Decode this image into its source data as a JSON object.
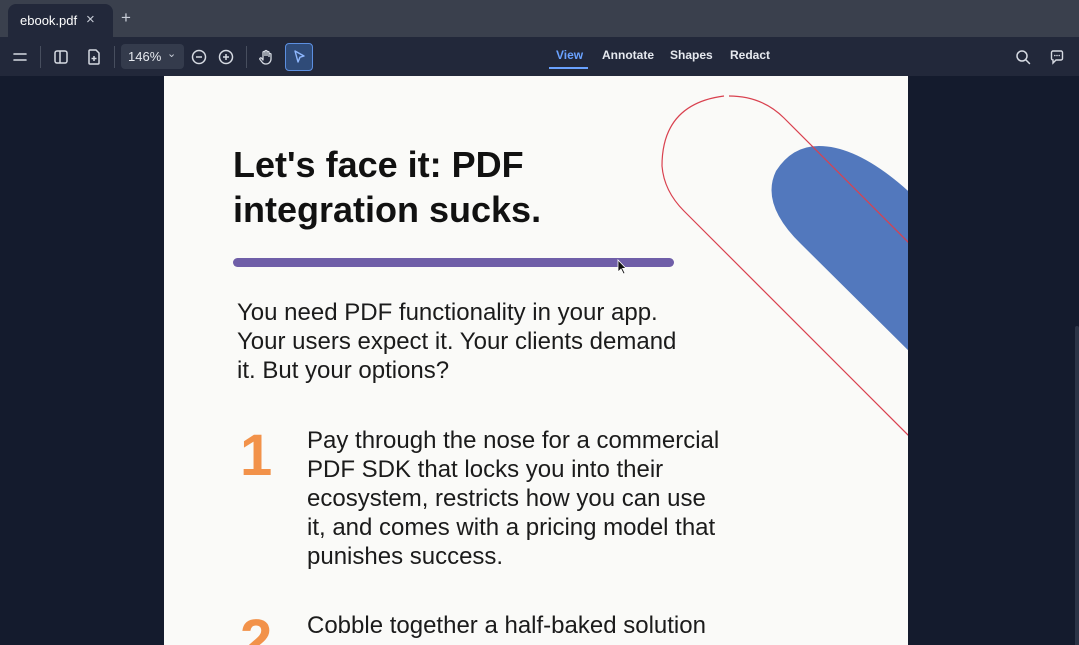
{
  "tabs": [
    {
      "title": "ebook.pdf"
    }
  ],
  "toolbar": {
    "zoom": "146%",
    "modes": [
      {
        "label": "View"
      },
      {
        "label": "Annotate"
      },
      {
        "label": "Shapes"
      },
      {
        "label": "Redact"
      }
    ],
    "active_mode": "View",
    "icons": [
      "menu-icon",
      "sidebar-icon",
      "document-plus-icon",
      "zoom-out-icon",
      "zoom-in-icon",
      "pan-hand-icon",
      "select-pointer-icon",
      "search-icon",
      "chat-icon"
    ]
  },
  "document": {
    "heading_line1": "Let's face it: PDF",
    "heading_line2": "integration sucks.",
    "intro_line1": "You need PDF functionality in your app.",
    "intro_line2": "Your users expect it. Your clients demand",
    "intro_line3": "it. But your options?",
    "items": [
      {
        "number": "1",
        "lines": [
          "Pay through the nose for a commercial",
          "PDF SDK that locks you into their",
          "ecosystem, restricts how you can use",
          "it, and comes with a pricing model that",
          "punishes success."
        ]
      },
      {
        "number": "2",
        "lines": [
          "Cobble together a half-baked solution"
        ]
      }
    ]
  },
  "colors": {
    "accent": "#6aa2ff",
    "purple": "#6f5ea8",
    "orange": "#f2924a",
    "blue_shape": "#5278bd",
    "red_outline": "#d9414f"
  }
}
